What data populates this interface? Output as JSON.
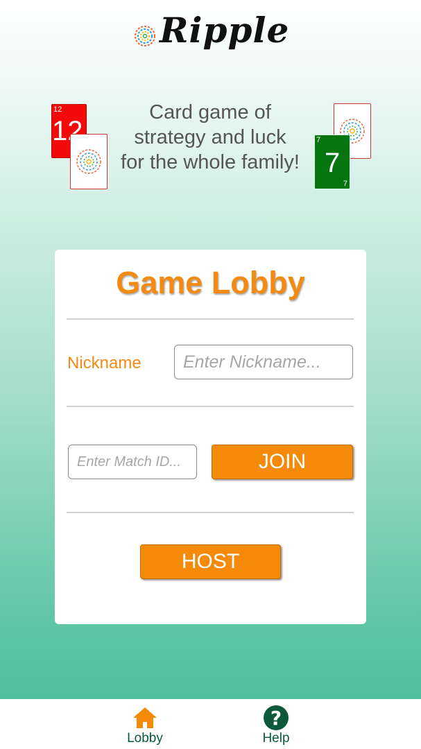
{
  "app": {
    "logo_text": "Ripple",
    "tagline_lines": [
      "Card game of",
      "strategy and luck",
      "for the whole family!"
    ]
  },
  "cards": {
    "left_front": {
      "value": "12",
      "corner": "12",
      "color": "#f40a0a"
    },
    "right_front": {
      "value": "7",
      "corner": "7",
      "color": "#06740f"
    }
  },
  "lobby": {
    "title": "Game Lobby",
    "nickname_label": "Nickname",
    "nickname_placeholder": "Enter Nickname...",
    "nickname_value": "",
    "match_id_placeholder": "Enter Match ID...",
    "match_id_value": "",
    "join_label": "JOIN",
    "host_label": "HOST"
  },
  "nav": {
    "items": [
      {
        "label": "Lobby",
        "icon": "home-icon",
        "active": true
      },
      {
        "label": "Help",
        "icon": "help-icon",
        "active": false
      }
    ]
  },
  "colors": {
    "accent": "#f48a08",
    "brand_green": "#0c5a3b",
    "background_bottom": "#45bc98"
  }
}
